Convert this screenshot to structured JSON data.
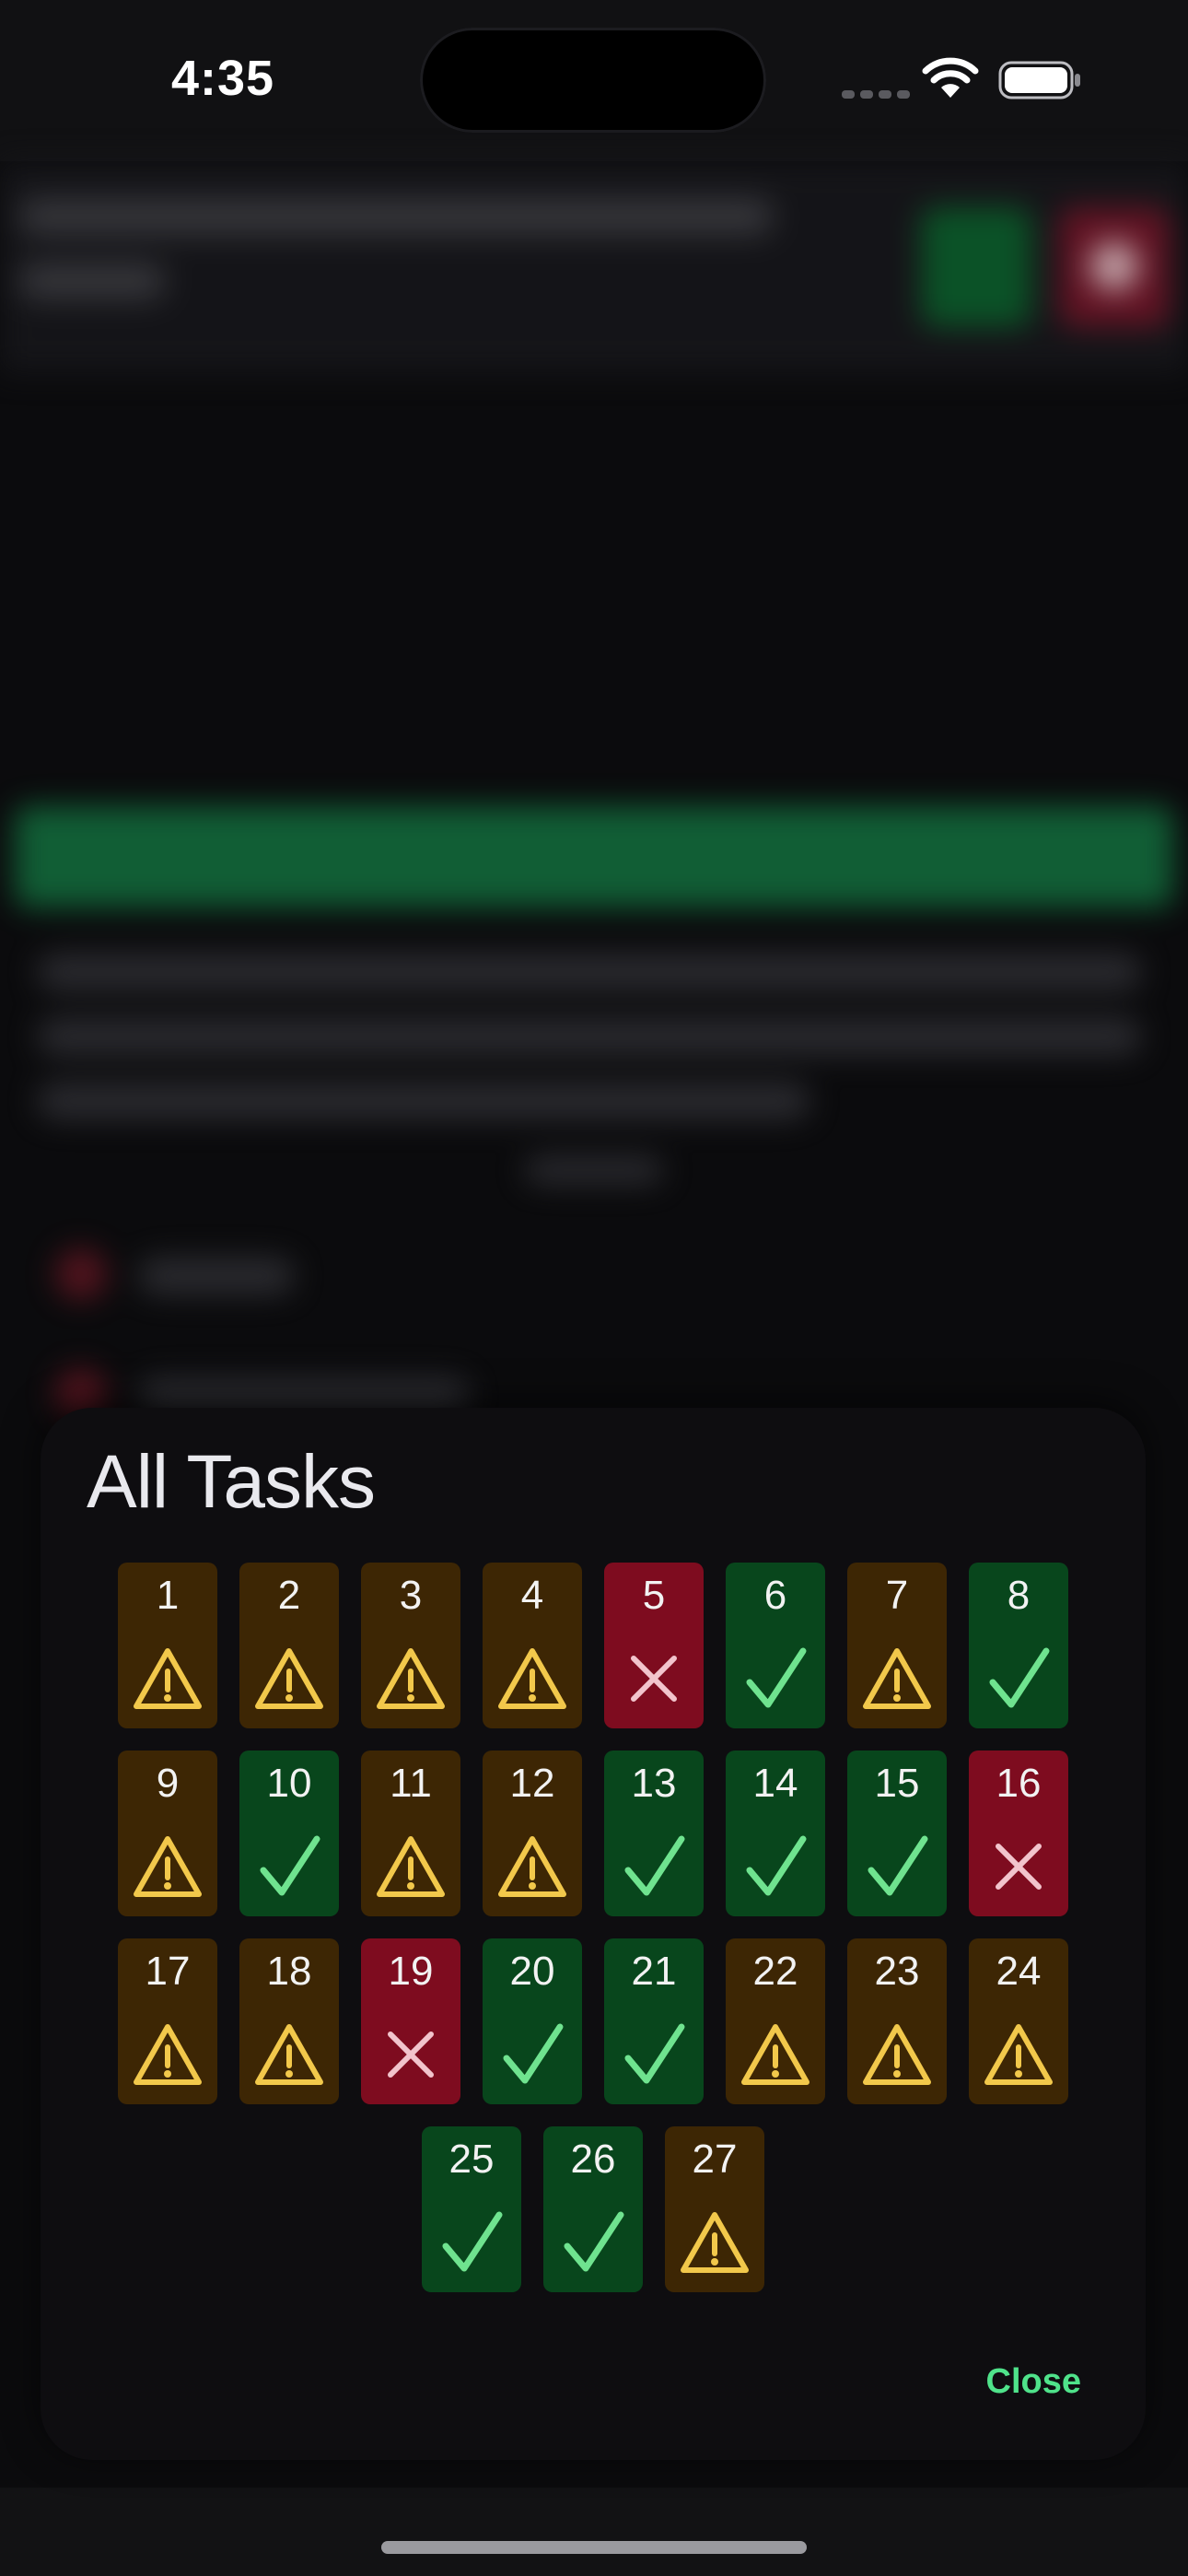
{
  "status_bar": {
    "time": "4:35"
  },
  "sheet": {
    "title": "All Tasks",
    "close_label": "Close",
    "tasks": [
      {
        "number": "1",
        "status": "warning"
      },
      {
        "number": "2",
        "status": "warning"
      },
      {
        "number": "3",
        "status": "warning"
      },
      {
        "number": "4",
        "status": "warning"
      },
      {
        "number": "5",
        "status": "failed"
      },
      {
        "number": "6",
        "status": "passed"
      },
      {
        "number": "7",
        "status": "warning"
      },
      {
        "number": "8",
        "status": "passed"
      },
      {
        "number": "9",
        "status": "warning"
      },
      {
        "number": "10",
        "status": "passed"
      },
      {
        "number": "11",
        "status": "warning"
      },
      {
        "number": "12",
        "status": "warning"
      },
      {
        "number": "13",
        "status": "passed"
      },
      {
        "number": "14",
        "status": "passed"
      },
      {
        "number": "15",
        "status": "passed"
      },
      {
        "number": "16",
        "status": "failed"
      },
      {
        "number": "17",
        "status": "warning"
      },
      {
        "number": "18",
        "status": "warning"
      },
      {
        "number": "19",
        "status": "failed"
      },
      {
        "number": "20",
        "status": "passed"
      },
      {
        "number": "21",
        "status": "passed"
      },
      {
        "number": "22",
        "status": "warning"
      },
      {
        "number": "23",
        "status": "warning"
      },
      {
        "number": "24",
        "status": "warning"
      },
      {
        "number": "25",
        "status": "passed"
      },
      {
        "number": "26",
        "status": "passed"
      },
      {
        "number": "27",
        "status": "warning"
      }
    ]
  },
  "icons": {
    "warning": "warning-triangle-icon",
    "passed": "checkmark-icon",
    "failed": "x-mark-icon"
  },
  "colors": {
    "warning_bg": "#3d2604",
    "warning_fg": "#f2c84b",
    "passed_bg": "#08461c",
    "passed_fg": "#6fe38f",
    "failed_bg": "#7e0c1f",
    "failed_fg": "#f2c4cc",
    "accent": "#4fe28a"
  }
}
